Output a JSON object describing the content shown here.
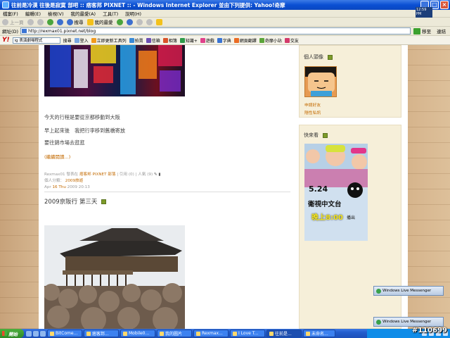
{
  "window": {
    "title": "往前是冷漠 往後是寂寞 部吧 :: 痞客邦 PIXNET :: - Windows Internet Explorer 並由下列提供: Yahoo!奇摩"
  },
  "menu": [
    "檔案(F)",
    "編輯(E)",
    "檢視(V)",
    "我的最愛(A)",
    "工具(T)",
    "說明(H)"
  ],
  "nav": {
    "back": "上一頁",
    "search": "搜尋",
    "favorites": "我的最愛"
  },
  "clock_widget": {
    "time": "12:59 PM"
  },
  "address": {
    "label": "網址(D)",
    "url": "http://rexmax01.pixnet.net/blog",
    "go": "移至",
    "links": "連結"
  },
  "yahoo_toolbar": {
    "search_text": "ig 表演劇場程式",
    "items": [
      "搜尋",
      "登入",
      "立即更新工具列",
      "拍賣",
      "信箱",
      "相簿",
      "知識+",
      "遊戲",
      "字典",
      "網頁翻譯",
      "奇摩小站",
      "交友"
    ]
  },
  "main": {
    "paragraphs": [
      "今天的行程是要從京都移動到大阪",
      "早上起來後　我把行李移到舊橋寄放",
      "要往錦市場去逛逛"
    ],
    "more_link": "(繼續閱讀...)",
    "meta_line1_prefix": "Rexmax01 發表在",
    "meta_line1_link": "痞客邦 PIXNET 部落",
    "meta_line1_suffix": "| 引用 (0) | 人氣 (9)",
    "meta_category_prefix": "個人分類：",
    "meta_category": "2009旅遊",
    "meta_date_prefix": "Apr",
    "meta_date": "16 Thu",
    "meta_date_suffix": "2009 20:13",
    "post_title": "2009京阪行 第三天"
  },
  "sidebar": {
    "profile_title": "個人頭像",
    "profile_links": [
      "申請好友",
      "隱性私訊"
    ],
    "ad_title": "快來看",
    "ad_lines": [
      "5.24",
      "衛視中文台",
      "晚上8:00",
      "播出"
    ]
  },
  "messenger": {
    "popup1": "Windows Live Messenger",
    "popup2": "Windows Live Messenger"
  },
  "taskbar": {
    "start": "開始",
    "tasks": [
      "BitCome...",
      "痞客邦...",
      "Mobile0...",
      "我的圖片",
      "Rexmax...",
      "I Love T...",
      "往前是...",
      "未命名..."
    ]
  },
  "watermark": "#110699"
}
